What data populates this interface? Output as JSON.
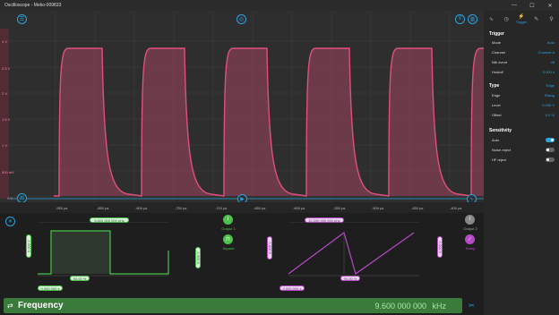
{
  "window": {
    "title": "Oscilloscope - Meko-009833",
    "minimize": "—",
    "maximize": "☐",
    "close": "✕"
  },
  "plot": {
    "trace_color": "#e0507a",
    "y_labels": [
      "4 V",
      "2.5 V",
      "2 V",
      "1.5 V",
      "1 V",
      "500 mV",
      "0 V"
    ],
    "x_labels": [
      "-950 µs",
      "-850 µs",
      "-800 µs",
      "-750 µs",
      "-700 µs",
      "-650 µs",
      "-600 µs",
      "-550 µs",
      "-500 µs",
      "-450 µs",
      "-400 µs"
    ],
    "pulse_count": 6
  },
  "panel": {
    "tabs": [
      {
        "icon": "∿",
        "label": ""
      },
      {
        "icon": "◷",
        "label": ""
      },
      {
        "icon": "⚡",
        "label": "Trigger"
      },
      {
        "icon": "✎",
        "label": ""
      },
      {
        "icon": "⚲",
        "label": ""
      }
    ],
    "trigger": {
      "heading": "Trigger",
      "rows": [
        {
          "label": "Mode",
          "value": "Auto"
        },
        {
          "label": "Channel",
          "value": "Channel A"
        },
        {
          "label": "Nth event",
          "value": "off"
        },
        {
          "label": "Holdoff",
          "value": "0.000 s"
        }
      ]
    },
    "type": {
      "heading": "Type",
      "rows": [
        {
          "label": "Edge",
          "value": "Rising"
        },
        {
          "label": "Level",
          "value": "0.000 V"
        },
        {
          "label": "Offset",
          "value": "0.0 %"
        }
      ],
      "type_value": "Edge"
    },
    "sensitivity": {
      "heading": "Sensitivity",
      "rows": [
        {
          "label": "Auto",
          "on": true
        },
        {
          "label": "Noise reject",
          "on": false
        },
        {
          "label": "HF reject",
          "on": false
        }
      ]
    }
  },
  "output1": {
    "frequency_pill": "9.600 000 000 kHz",
    "amplitude_pill": "5.000 V",
    "offset_pill": "0.000 V",
    "duty_pill": "50.00 %",
    "bottom_pill": "0.000 000 s",
    "label": "Output 1",
    "wave_label": "Square",
    "color": "#4cc24c"
  },
  "output2": {
    "frequency_pill": "10.000 000 000 kHz",
    "amplitude_pill": "3.000 V",
    "offset_pill": "0.000 V",
    "duty_pill": "90.00 %",
    "bottom_pill": "0.000 000 s",
    "label": "Output 2",
    "wave_label": "Ramp",
    "color": "#b44bc4"
  },
  "measure": {
    "title": "Frequency",
    "value": "9.600 000 000",
    "unit": "kHz"
  }
}
